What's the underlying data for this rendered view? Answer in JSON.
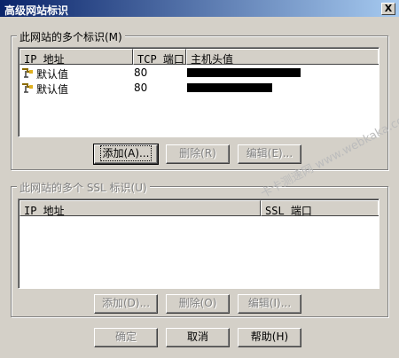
{
  "dialog": {
    "title": "高级网站标识",
    "close_label": "X"
  },
  "identities_group": {
    "label": "此网站的多个标识(M)",
    "columns": [
      "IP 地址",
      "TCP 端口",
      "主机头值"
    ],
    "rows": [
      {
        "ip": "默认值",
        "port": "80",
        "host": "[redacted]"
      },
      {
        "ip": "默认值",
        "port": "80",
        "host": "[redacted]"
      }
    ],
    "buttons": {
      "add": "添加(A)...",
      "remove": "删除(R)",
      "edit": "编辑(E)..."
    }
  },
  "ssl_group": {
    "label": "此网站的多个 SSL 标识(U)",
    "columns": [
      "IP 地址",
      "SSL 端口"
    ],
    "buttons": {
      "add": "添加(D)...",
      "remove": "删除(O)",
      "edit": "编辑(I)..."
    }
  },
  "footer": {
    "ok": "确定",
    "cancel": "取消",
    "help": "帮助(H)"
  },
  "watermark": {
    "line1": "卡卡测速网 www.webkaka.com"
  },
  "icons": {
    "site": "site-icon",
    "close": "close-icon"
  }
}
